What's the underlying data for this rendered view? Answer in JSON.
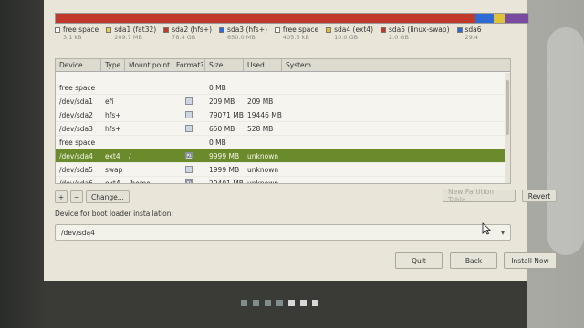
{
  "partition_bar": {
    "segments": [
      {
        "color": "#c0392b",
        "flex": 72
      },
      {
        "color": "#2f6bd4",
        "flex": 3
      },
      {
        "color": "#e0c13a",
        "flex": 2
      },
      {
        "color": "#7a4aa0",
        "flex": 4
      }
    ]
  },
  "legend": [
    {
      "label": "free space",
      "size": "3.1 kB",
      "color": "#ffffff"
    },
    {
      "label": "sda1 (fat32)",
      "size": "209.7 MB",
      "color": "#e6d14b"
    },
    {
      "label": "sda2 (hfs+)",
      "size": "78.4 GB",
      "color": "#c0392b"
    },
    {
      "label": "sda3 (hfs+)",
      "size": "650.0 MB",
      "color": "#2f6bd4"
    },
    {
      "label": "free space",
      "size": "405.5 kB",
      "color": "#ffffff"
    },
    {
      "label": "sda4 (ext4)",
      "size": "10.0 GB",
      "color": "#e0c13a"
    },
    {
      "label": "sda5 (linux-swap)",
      "size": "2.0 GB",
      "color": "#c0392b"
    },
    {
      "label": "sda6",
      "size": "29.4",
      "color": "#2f6bd4"
    }
  ],
  "table": {
    "headers": {
      "device": "Device",
      "type": "Type",
      "mount": "Mount point",
      "format": "Format?",
      "size": "Size",
      "used": "Used",
      "system": "System"
    },
    "rows": [
      {
        "device": "free space",
        "type": "",
        "mount": "",
        "format": "",
        "size": "0 MB",
        "used": "",
        "system": "",
        "checkbox": false,
        "selected": false
      },
      {
        "device": "/dev/sda1",
        "type": "efi",
        "mount": "",
        "format": "",
        "size": "209 MB",
        "used": "209 MB",
        "system": "",
        "checkbox": true,
        "selected": false
      },
      {
        "device": "/dev/sda2",
        "type": "hfs+",
        "mount": "",
        "format": "",
        "size": "79071 MB",
        "used": "19446 MB",
        "system": "",
        "checkbox": true,
        "selected": false
      },
      {
        "device": "/dev/sda3",
        "type": "hfs+",
        "mount": "",
        "format": "",
        "size": "650 MB",
        "used": "528 MB",
        "system": "",
        "checkbox": true,
        "selected": false
      },
      {
        "device": "free space",
        "type": "",
        "mount": "",
        "format": "",
        "size": "0 MB",
        "used": "",
        "system": "",
        "checkbox": false,
        "selected": false
      },
      {
        "device": "/dev/sda4",
        "type": "ext4",
        "mount": "/",
        "format": "☑",
        "size": "9999 MB",
        "used": "unknown",
        "system": "",
        "checkbox": true,
        "selected": true
      },
      {
        "device": "/dev/sda5",
        "type": "swap",
        "mount": "",
        "format": "",
        "size": "1999 MB",
        "used": "unknown",
        "system": "",
        "checkbox": true,
        "selected": false
      },
      {
        "device": "/dev/sda6",
        "type": "ext4",
        "mount": "/home",
        "format": "☑",
        "size": "29401 MB",
        "used": "unknown",
        "system": "",
        "checkbox": true,
        "selected": false
      }
    ]
  },
  "toolbar": {
    "add_label": "+",
    "remove_label": "−",
    "change_label": "Change...",
    "new_table_label": "New Partition Table...",
    "revert_label": "Revert"
  },
  "boot": {
    "label": "Device for boot loader installation:",
    "value": "/dev/sda4"
  },
  "actions": {
    "quit": "Quit",
    "back": "Back",
    "install": "Install Now"
  }
}
